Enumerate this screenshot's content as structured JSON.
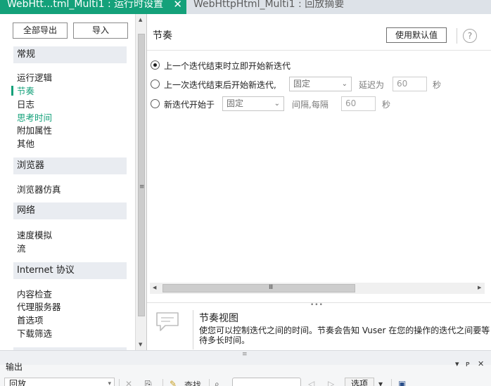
{
  "tabs": [
    {
      "label": "WebHtt...tml_Multi1 : 运行时设置",
      "close": "✕",
      "active": true
    },
    {
      "label": "WebHttpHtml_Multi1 : 回放摘要",
      "active": false
    }
  ],
  "left": {
    "export_label": "全部导出",
    "import_label": "导入",
    "categories": [
      {
        "header": "常规",
        "items": [
          "运行逻辑",
          "节奏",
          "日志",
          "思考时间",
          "附加属性",
          "其他"
        ]
      },
      {
        "header": "浏览器",
        "items": [
          "浏览器仿真"
        ]
      },
      {
        "header": "网络",
        "items": [
          "速度模拟",
          "流"
        ]
      },
      {
        "header": "Internet 协议",
        "items": [
          "内容检查",
          "代理服务器",
          "首选项",
          "下载筛选"
        ]
      }
    ]
  },
  "pacing": {
    "title": "节奏",
    "defaults_button": "使用默认值",
    "help_glyph": "?",
    "options": [
      {
        "label": "上一个迭代结束时立即开始新迭代",
        "checked": true
      },
      {
        "label": "上一次迭代结束后开始新迭代,",
        "select_value": "固定",
        "mid_label": "延迟为",
        "input_value": "60",
        "unit": "秒",
        "checked": false
      },
      {
        "label": "新迭代开始于",
        "select_value": "固定",
        "mid_label": "间隔,每隔",
        "input_value": "60",
        "unit": "秒",
        "checked": false
      }
    ],
    "description_title": "节奏视图",
    "description_text": "使您可以控制迭代之间的时间。节奏会告知 Vuser 在您的操作的迭代之间要等待多长时间。"
  },
  "output": {
    "title": "输出",
    "pin": "ᵖ",
    "source_select": "回放",
    "find_label": "查找",
    "options_label": "选项"
  },
  "icons": {
    "accent_color": "#14a17a"
  }
}
